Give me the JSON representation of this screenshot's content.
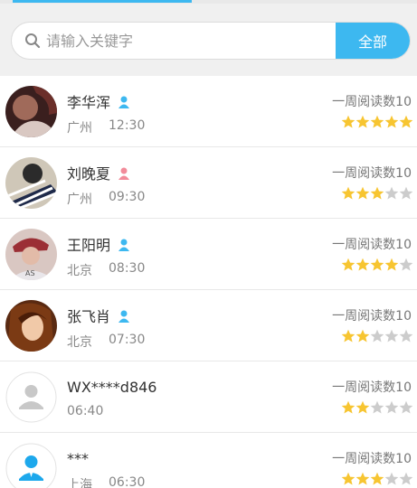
{
  "search": {
    "placeholder": "请输入关键字",
    "value": "",
    "button_label": "全部"
  },
  "colors": {
    "accent": "#3db8f0",
    "star_on": "#f7c531",
    "star_off": "#cccccc",
    "male": "#3db8f0",
    "female": "#f28b9a"
  },
  "users": [
    {
      "name": "李华浑",
      "gender": "male",
      "city": "广州",
      "time": "12:30",
      "reads": "一周阅读数10",
      "rating": 5,
      "avatar": "photo-dark"
    },
    {
      "name": "刘晚夏",
      "gender": "female",
      "city": "广州",
      "time": "09:30",
      "reads": "一周阅读数10",
      "rating": 3,
      "avatar": "photo-striped"
    },
    {
      "name": "王阳明",
      "gender": "male",
      "city": "北京",
      "time": "08:30",
      "reads": "一周阅读数10",
      "rating": 4,
      "avatar": "photo-hat"
    },
    {
      "name": "张飞肖",
      "gender": "male",
      "city": "北京",
      "time": "07:30",
      "reads": "一周阅读数10",
      "rating": 2,
      "avatar": "photo-girl"
    },
    {
      "name": "WX****d846",
      "gender": "",
      "city": "",
      "time": "06:40",
      "reads": "一周阅读数10",
      "rating": 2,
      "avatar": "default-gray"
    },
    {
      "name": "***",
      "gender": "",
      "city": "上海",
      "time": "06:30",
      "reads": "一周阅读数10",
      "rating": 3,
      "avatar": "default-blue"
    }
  ]
}
